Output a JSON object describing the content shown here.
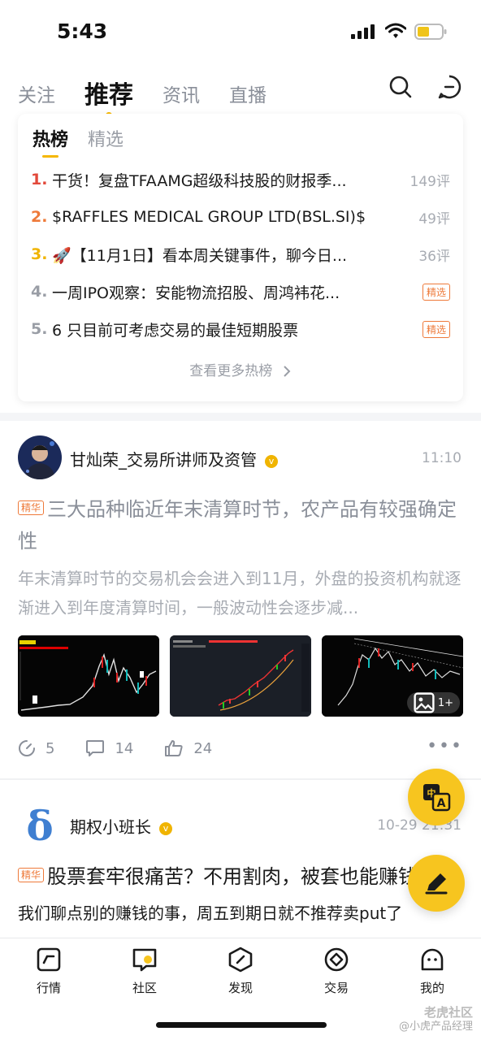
{
  "status_bar": {
    "time": "5:43"
  },
  "top_tabs": [
    "关注",
    "推荐",
    "资讯",
    "直播"
  ],
  "hot_card": {
    "tabs": [
      "热榜",
      "精选"
    ],
    "items": [
      {
        "rank": "1.",
        "rank_color": "#e2493b",
        "title": "干货！复盘TFAAMG超级科技股的财报季...",
        "meta": "149评",
        "tag": ""
      },
      {
        "rank": "2.",
        "rank_color": "#ee7a3a",
        "title": "$RAFFLES MEDICAL GROUP LTD(BSL.SI)$",
        "meta": "49评",
        "tag": ""
      },
      {
        "rank": "3.",
        "rank_color": "#f0b400",
        "title": "🚀【11月1日】看本周关键事件，聊今日...",
        "meta": "36评",
        "tag": ""
      },
      {
        "rank": "4.",
        "rank_color": "#9a9ea6",
        "title": "一周IPO观察：安能物流招股、周鸿袆花...",
        "meta": "",
        "tag": "精选"
      },
      {
        "rank": "5.",
        "rank_color": "#9a9ea6",
        "title": "6 只目前可考虑交易的最佳短期股票",
        "meta": "",
        "tag": "精选"
      }
    ],
    "more_label": "查看更多热榜"
  },
  "post1": {
    "author": "甘灿荣_交易所讲师及资管",
    "time": "11:10",
    "tag": "精华",
    "title": "三大品种临近年末清算时节，农产品有较强确定性",
    "summary": "年末清算时节的交易机会会进入到11月，外盘的投资机构就逐渐进入到年度清算时间，一般波动性会逐步减...",
    "image_more": "1+",
    "reads": "5",
    "comments": "14",
    "likes": "24"
  },
  "post2": {
    "author": "期权小班长",
    "time": "10-29 21:31",
    "tag": "精华",
    "title": "股票套牢很痛苦？不用割肉，被套也能赚钱",
    "summary": "我们聊点别的赚钱的事，周五到期日就不推荐卖put了"
  },
  "translate_fab": {
    "small": "中",
    "big": "A"
  },
  "bottom_nav": [
    "行情",
    "社区",
    "发现",
    "交易",
    "我的"
  ],
  "watermark": {
    "line1": "老虎社区",
    "line2": "@小虎产品经理"
  },
  "colors": {
    "accent": "#f7c51f",
    "essence": "#ee7a3a"
  }
}
